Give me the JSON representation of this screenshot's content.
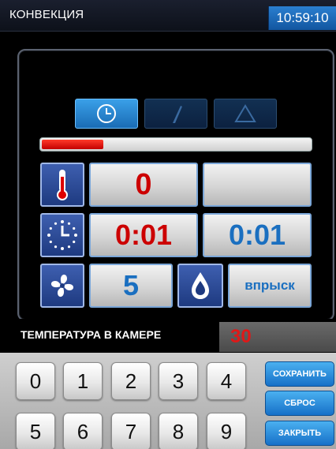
{
  "header": {
    "title": "КОНВЕКЦИЯ",
    "clock": "10:59:10"
  },
  "modes": [
    {
      "icon": "clock-icon",
      "active": true
    },
    {
      "icon": "probe-icon",
      "active": false
    },
    {
      "icon": "triangle-icon",
      "active": false
    }
  ],
  "progress": {
    "fraction": 0.23,
    "color": "#d40000"
  },
  "rows": {
    "temperature": {
      "icon": "thermometer-icon",
      "value": "0",
      "extra": ""
    },
    "time": {
      "icon": "timer-icon",
      "value": "0:01",
      "extra": "0:01"
    },
    "fan": {
      "icon": "fan-icon",
      "value": "5",
      "extra_icon": "water-drop-icon",
      "extra": "впрыск"
    }
  },
  "status": {
    "label": "ТЕМПЕРАТУРА В КАМЕРЕ",
    "value": "30"
  },
  "keypad": {
    "keys": [
      "0",
      "1",
      "2",
      "3",
      "4",
      "5",
      "6",
      "7",
      "8",
      "9"
    ]
  },
  "actions": {
    "save": "СОХРАНИТЬ",
    "reset": "СБРОС",
    "close": "ЗАКРЫТЬ"
  },
  "colors": {
    "accent": "#1a6fc0",
    "value_red": "#cc0000",
    "header_clock": "#2a7fd0"
  }
}
